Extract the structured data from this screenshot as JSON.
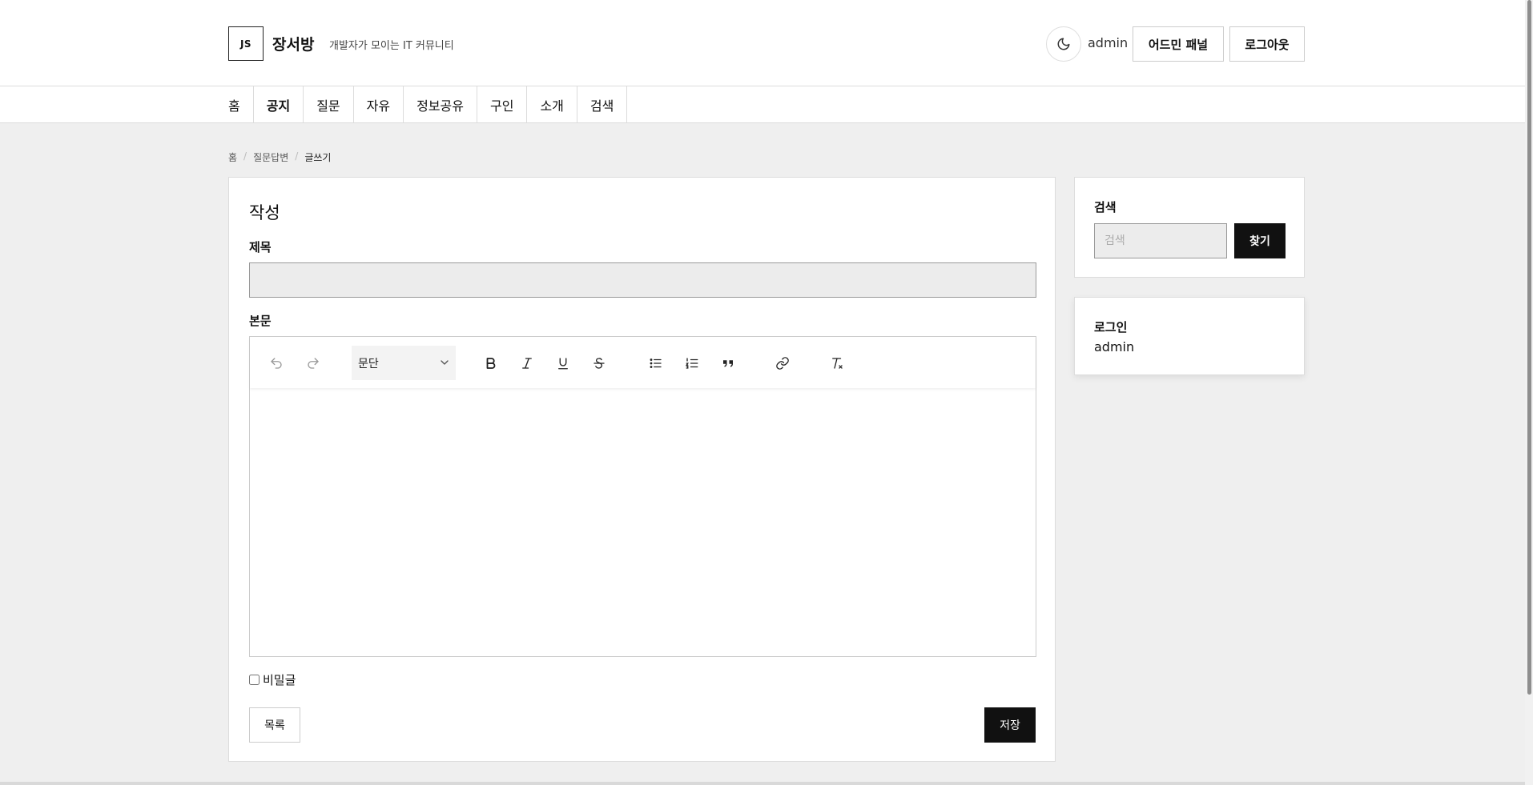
{
  "header": {
    "logo_text": "JS",
    "site_title": "장서방",
    "tagline": "개발자가 모이는 IT 커뮤니티",
    "username": "admin",
    "admin_panel_label": "어드민 패널",
    "logout_label": "로그아웃"
  },
  "nav": {
    "items": [
      {
        "label": "홈"
      },
      {
        "label": "공지"
      },
      {
        "label": "질문"
      },
      {
        "label": "자유"
      },
      {
        "label": "정보공유"
      },
      {
        "label": "구인"
      },
      {
        "label": "소개"
      },
      {
        "label": "검색"
      }
    ]
  },
  "breadcrumb": {
    "items": [
      "홈",
      "질문답변",
      "글쓰기"
    ]
  },
  "form": {
    "heading": "작성",
    "title_label": "제목",
    "title_value": "",
    "body_label": "본문",
    "paragraph_select": "문단",
    "secret_label": "비밀글",
    "secret_checked": false,
    "list_button": "목록",
    "save_button": "저장"
  },
  "toolbar": {
    "icons": [
      "undo-icon",
      "redo-icon",
      "bold-icon",
      "italic-icon",
      "underline-icon",
      "strikethrough-icon",
      "bullet-list-icon",
      "numbered-list-icon",
      "blockquote-icon",
      "link-icon",
      "clear-format-icon"
    ]
  },
  "sidebar": {
    "search_label": "검색",
    "search_placeholder": "검색",
    "search_button": "찾기",
    "login_label": "로그인",
    "login_user": "admin"
  }
}
